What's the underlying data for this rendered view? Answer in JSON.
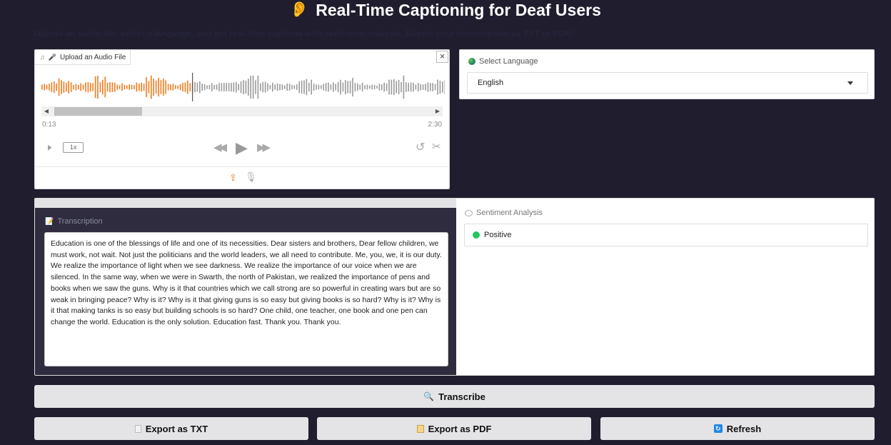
{
  "header": {
    "title": "Real-Time Captioning for Deaf Users",
    "subtitle": "Upload an audio file, select a language, and get real-time captions with sentiment analysis. Export your transcription as TXT or PDF!"
  },
  "audio": {
    "tab_label": "Upload an Audio File",
    "time_current": "0:13",
    "time_total": "2:30",
    "speed": "1x",
    "close_symbol": "×"
  },
  "language": {
    "label": "Select Language",
    "selected": "English"
  },
  "transcription": {
    "label": "Transcription",
    "text": " Education is one of the blessings of life and one of its necessities. Dear sisters and brothers, Dear fellow children, we must work, not wait. Not just the politicians and the world leaders, we all need to contribute. Me, you, we, it is our duty. We realize the importance of light when we see darkness. We realize the importance of our voice when we are silenced. In the same way, when we were in Swarth, the north of Pakistan, we realized the importance of pens and books when we saw the guns. Why is it that countries which we call strong are so powerful in creating wars but are so weak in bringing peace? Why is it? Why is it that giving guns is so easy but giving books is so hard? Why is it? Why is it that making tanks is so easy but building schools is so hard? One child, one teacher, one book and one pen can change the world. Education is the only solution. Education fast. Thank you. Thank you."
  },
  "sentiment": {
    "label": "Sentiment Analysis",
    "value": "Positive",
    "color": "#22c55e"
  },
  "buttons": {
    "transcribe": "Transcribe",
    "export_txt": "Export as TXT",
    "export_pdf": "Export as PDF",
    "refresh": "Refresh"
  },
  "colors": {
    "background": "#1f1d2e",
    "accent_orange": "#f07b1e",
    "button_bg": "#e4e4e7"
  },
  "icons": {
    "title": "ear-icon",
    "audio_tab": "microphone-icon",
    "language": "globe-icon",
    "transcription": "memo-icon",
    "sentiment": "speech-bubble-icon",
    "transcribe": "magnifier-icon",
    "export_txt": "document-icon",
    "export_pdf": "scroll-icon",
    "refresh": "refresh-icon"
  }
}
